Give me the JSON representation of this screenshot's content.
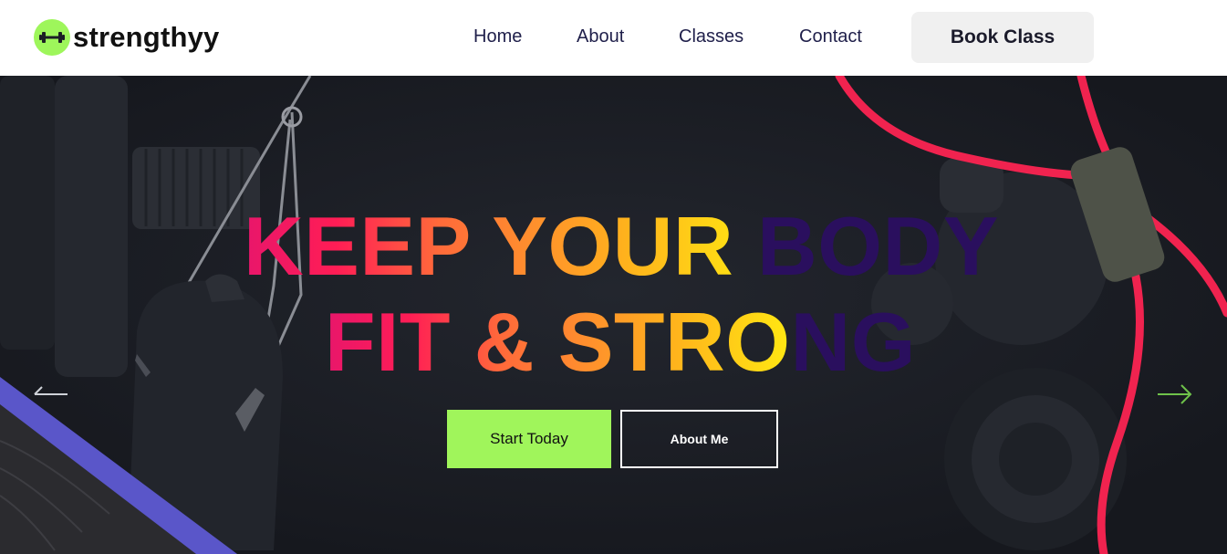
{
  "brand": {
    "name": "strengthyy",
    "badge_color": "#9ef65b",
    "icon": "dumbbell-icon"
  },
  "nav": {
    "items": [
      {
        "label": "Home"
      },
      {
        "label": "About"
      },
      {
        "label": "Classes"
      },
      {
        "label": "Contact"
      }
    ],
    "cta_label": "Book Class"
  },
  "hero": {
    "headline": {
      "line1_lit": "KEEP YOUR ",
      "line1_dim": "BODY",
      "line2_lit": "FIT & STRO",
      "line2_dim": "NG"
    },
    "primary_button": "Start Today",
    "secondary_button": "About Me",
    "prev_icon": "arrow-left-icon",
    "next_icon": "arrow-right-icon",
    "colors": {
      "background": "#1b1e25",
      "accent_green": "#a0f55b",
      "gradient_start": "#e8166b",
      "gradient_end": "#ffe812",
      "dim_text": "#2a0f5e",
      "band_red": "#f0234f"
    }
  }
}
